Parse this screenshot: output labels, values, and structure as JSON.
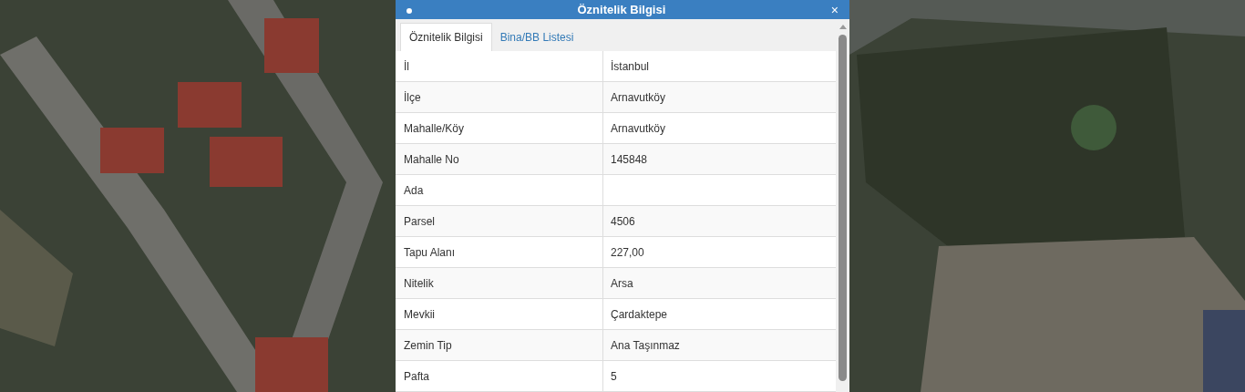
{
  "dialog": {
    "title": "Öznitelik Bilgisi",
    "close": "×",
    "tabs": [
      {
        "label": "Öznitelik Bilgisi",
        "selected": true
      },
      {
        "label": "Bina/BB Listesi",
        "selected": false
      }
    ],
    "rows": [
      {
        "label": "İl",
        "value": "İstanbul"
      },
      {
        "label": "İlçe",
        "value": "Arnavutköy"
      },
      {
        "label": "Mahalle/Köy",
        "value": "Arnavutköy"
      },
      {
        "label": "Mahalle No",
        "value": "145848"
      },
      {
        "label": "Ada"
      },
      {
        "label": "Parsel",
        "value": "4506"
      },
      {
        "label": "Tapu Alanı",
        "value": "227,00"
      },
      {
        "label": "Nitelik",
        "value": "Arsa"
      },
      {
        "label": "Mevkii",
        "value": "Çardaktepe"
      },
      {
        "label": "Zemin Tip",
        "value": "Ana Taşınmaz"
      },
      {
        "label": "Pafta",
        "value": "5"
      }
    ]
  }
}
